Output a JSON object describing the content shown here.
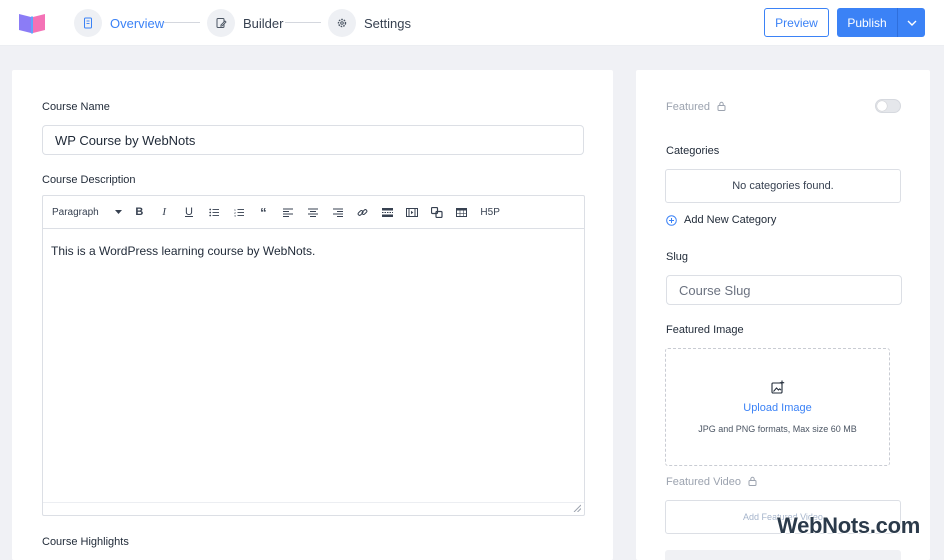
{
  "header": {
    "steps": [
      {
        "label": "Overview",
        "icon": "document-icon",
        "active": true
      },
      {
        "label": "Builder",
        "icon": "edit-icon",
        "active": false
      },
      {
        "label": "Settings",
        "icon": "gear-icon",
        "active": false
      }
    ],
    "preview_label": "Preview",
    "publish_label": "Publish"
  },
  "main": {
    "course_name_label": "Course Name",
    "course_name_value": "WP Course by WebNots",
    "course_description_label": "Course Description",
    "editor": {
      "format_value": "Paragraph",
      "toolbar": [
        "bold",
        "italic",
        "underline",
        "bullet-list",
        "numbered-list",
        "blockquote",
        "align-left",
        "align-center",
        "align-right",
        "link",
        "read-more",
        "media",
        "shortcode",
        "table",
        "H5P"
      ],
      "h5p_label": "H5P",
      "content": "This is a WordPress learning course by WebNots."
    },
    "course_highlights_label": "Course Highlights"
  },
  "sidebar": {
    "featured_label": "Featured",
    "featured_enabled": false,
    "categories_label": "Categories",
    "categories_empty": "No categories found.",
    "add_category_label": "Add New Category",
    "slug_label": "Slug",
    "slug_placeholder": "Course Slug",
    "featured_image_label": "Featured Image",
    "upload_title": "Upload Image",
    "upload_hint": "JPG and PNG formats, Max size 60 MB",
    "featured_video_label": "Featured Video",
    "add_video_label": "Add Featured Video"
  },
  "watermark": "WebNots.com",
  "colors": {
    "accent": "#3b82f6",
    "background": "#f0f1f5",
    "panel": "#ffffff"
  }
}
